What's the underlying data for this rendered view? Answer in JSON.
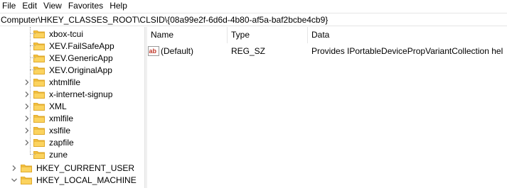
{
  "menu": {
    "items": [
      "File",
      "Edit",
      "View",
      "Favorites",
      "Help"
    ]
  },
  "address": {
    "path": "Computer\\HKEY_CLASSES_ROOT\\CLSID\\{08a99e2f-6d6d-4b80-af5a-baf2bcbe4cb9}"
  },
  "tree": {
    "items": [
      {
        "label": "xbox-tcui",
        "expander": false
      },
      {
        "label": "XEV.FailSafeApp",
        "expander": false
      },
      {
        "label": "XEV.GenericApp",
        "expander": false
      },
      {
        "label": "XEV.OriginalApp",
        "expander": false
      },
      {
        "label": "xhtmlfile",
        "expander": true
      },
      {
        "label": "x-internet-signup",
        "expander": true
      },
      {
        "label": "XML",
        "expander": true
      },
      {
        "label": "xmlfile",
        "expander": true
      },
      {
        "label": "xslfile",
        "expander": true
      },
      {
        "label": "zapfile",
        "expander": true
      },
      {
        "label": "zune",
        "expander": false
      },
      {
        "label": "HKEY_CURRENT_USER",
        "expander": true,
        "expanded": false
      },
      {
        "label": "HKEY_LOCAL_MACHINE",
        "expander": true,
        "expanded": true
      }
    ]
  },
  "list": {
    "headers": {
      "name": "Name",
      "type": "Type",
      "data": "Data"
    },
    "rows": [
      {
        "name": "(Default)",
        "type": "REG_SZ",
        "data": "Provides IPortableDevicePropVariantCollection hel..."
      }
    ]
  },
  "colors": {
    "folder": "#f8c646",
    "folder_dark": "#e0a92a",
    "chevron": "#707070"
  }
}
